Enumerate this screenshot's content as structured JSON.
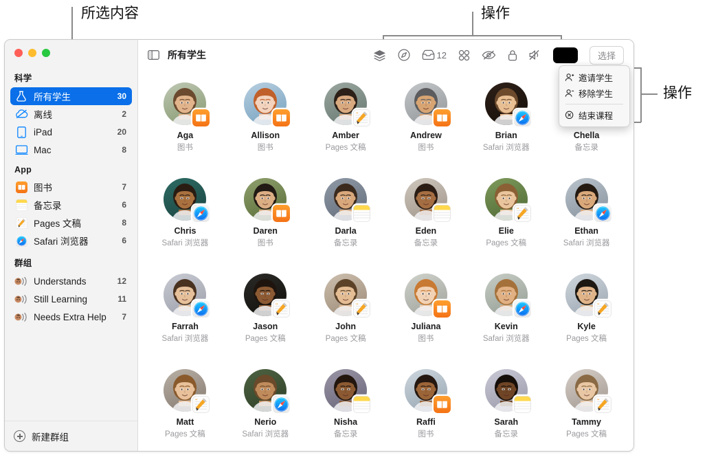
{
  "annotations": [
    {
      "id": "selection",
      "label": "所选内容"
    },
    {
      "id": "actions-top",
      "label": "操作"
    },
    {
      "id": "actions-right",
      "label": "操作"
    }
  ],
  "window": {
    "traffic_lights": [
      "close-red",
      "minimize-yellow",
      "zoom-green"
    ]
  },
  "sidebar": {
    "sections": [
      {
        "title": "科学",
        "items": [
          {
            "icon": "class-flask-icon",
            "label": "所有学生",
            "count": "30",
            "selected": true
          },
          {
            "icon": "offline-cloud-slash-icon",
            "label": "离线",
            "count": "2",
            "selected": false
          },
          {
            "icon": "ipad-icon",
            "label": "iPad",
            "count": "20",
            "selected": false
          },
          {
            "icon": "mac-icon",
            "label": "Mac",
            "count": "8",
            "selected": false
          }
        ]
      },
      {
        "title": "App",
        "items": [
          {
            "icon": "books-app-icon",
            "label": "图书",
            "count": "7",
            "selected": false
          },
          {
            "icon": "notes-app-icon",
            "label": "备忘录",
            "count": "6",
            "selected": false
          },
          {
            "icon": "pages-app-icon",
            "label": "Pages 文稿",
            "count": "8",
            "selected": false
          },
          {
            "icon": "safari-app-icon",
            "label": "Safari 浏览器",
            "count": "6",
            "selected": false
          }
        ]
      },
      {
        "title": "群组",
        "items": [
          {
            "icon": "group-icon",
            "label": "Understands",
            "count": "12",
            "selected": false
          },
          {
            "icon": "group-icon",
            "label": "Still Learning",
            "count": "11",
            "selected": false
          },
          {
            "icon": "group-icon",
            "label": "Needs Extra Help",
            "count": "7",
            "selected": false
          }
        ]
      }
    ],
    "new_group_label": "新建群组"
  },
  "toolbar": {
    "sidebar_toggle_icon": "sidebar-toggle-icon",
    "title": "所有学生",
    "actions": [
      {
        "icon": "layers-icon",
        "label": ""
      },
      {
        "icon": "navigate-compass-icon",
        "label": ""
      },
      {
        "icon": "inbox-icon",
        "label": "12"
      },
      {
        "icon": "grid-apps-icon",
        "label": ""
      },
      {
        "icon": "eye-slash-icon",
        "label": ""
      },
      {
        "icon": "lock-icon",
        "label": ""
      },
      {
        "icon": "speaker-mute-icon",
        "label": ""
      },
      {
        "icon": "screen-black-icon",
        "label": ""
      }
    ],
    "select_button": "选择"
  },
  "popup_menu": {
    "items": [
      {
        "icon": "person-add-icon",
        "label": "邀请学生"
      },
      {
        "icon": "person-remove-icon",
        "label": "移除学生"
      },
      {
        "icon": "end-class-icon",
        "label": "结束课程"
      }
    ],
    "separator_after_index": 1
  },
  "students": [
    {
      "name": "Aga",
      "app": "图书",
      "badge": "books-app-icon",
      "skin": "#e2b48c",
      "hair": "#6b4a2f",
      "bg": "#bfc8b4",
      "bgg": "#8fa07a"
    },
    {
      "name": "Allison",
      "app": "图书",
      "badge": "books-app-icon",
      "skin": "#f3d3bd",
      "hair": "#c0602a",
      "bg": "#b8cfe0",
      "bgg": "#7fa8c4"
    },
    {
      "name": "Amber",
      "app": "Pages 文稿",
      "badge": "pages-app-icon",
      "skin": "#d9a97f",
      "hair": "#2c2018",
      "bg": "#9aa7a0",
      "bgg": "#6f7f78"
    },
    {
      "name": "Andrew",
      "app": "图书",
      "badge": "books-app-icon",
      "skin": "#d7a472",
      "hair": "#5c5c5e",
      "bg": "#c4c7c9",
      "bgg": "#9a9da0"
    },
    {
      "name": "Brian",
      "app": "Safari 浏览器",
      "badge": "safari-app-icon",
      "skin": "#e8bf93",
      "hair": "#6d4a2c",
      "bg": "#2d2018",
      "bgg": "#1a120c"
    },
    {
      "name": "Chella",
      "app": "备忘录",
      "badge": "notes-app-icon",
      "skin": "#caa077",
      "hair": "#3a2a1c",
      "bg": "#9fae84",
      "bgg": "#72855c"
    },
    {
      "name": "Chris",
      "app": "Safari 浏览器",
      "badge": "safari-app-icon",
      "skin": "#a9713f",
      "hair": "#2a1c12",
      "bg": "#2d6b64",
      "bgg": "#1e4a46"
    },
    {
      "name": "Daren",
      "app": "图书",
      "badge": "books-app-icon",
      "skin": "#dcae84",
      "hair": "#221a14",
      "bg": "#8fa06e",
      "bgg": "#62753f"
    },
    {
      "name": "Darla",
      "app": "备忘录",
      "badge": "notes-app-icon",
      "skin": "#d8a87c",
      "hair": "#3b2a1e",
      "bg": "#8f99a6",
      "bgg": "#6a7482"
    },
    {
      "name": "Eden",
      "app": "备忘录",
      "badge": "notes-app-icon",
      "skin": "#a56e42",
      "hair": "#2b1d14",
      "bg": "#cfc7bd",
      "bgg": "#a79c90"
    },
    {
      "name": "Elie",
      "app": "Pages 文稿",
      "badge": "pages-app-icon",
      "skin": "#e9c49c",
      "hair": "#8a6034",
      "bg": "#7f9b5c",
      "bgg": "#55703a"
    },
    {
      "name": "Ethan",
      "app": "Safari 浏览器",
      "badge": "safari-app-icon",
      "skin": "#d9a87a",
      "hair": "#241a12",
      "bg": "#b9c3cc",
      "bgg": "#8e99a4"
    },
    {
      "name": "Farrah",
      "app": "Safari 浏览器",
      "badge": "safari-app-icon",
      "skin": "#e6c09a",
      "hair": "#4a3220",
      "bg": "#c9cbd3",
      "bgg": "#a3a6b0"
    },
    {
      "name": "Jason",
      "app": "Pages 文稿",
      "badge": "pages-app-icon",
      "skin": "#8c5a33",
      "hair": "#1f150e",
      "bg": "#2b2a28",
      "bgg": "#15140f"
    },
    {
      "name": "John",
      "app": "Pages 文稿",
      "badge": "pages-app-icon",
      "skin": "#e4bd95",
      "hair": "#5c4228",
      "bg": "#cdbfae",
      "bgg": "#a3927f"
    },
    {
      "name": "Juliana",
      "app": "图书",
      "badge": "books-app-icon",
      "skin": "#f2d2b5",
      "hair": "#c87a33",
      "bg": "#cfd2cb",
      "bgg": "#a6aaa2"
    },
    {
      "name": "Kevin",
      "app": "Safari 浏览器",
      "badge": "safari-app-icon",
      "skin": "#e1b083",
      "hair": "#a5713a",
      "bg": "#c7cdc6",
      "bgg": "#9ba49a"
    },
    {
      "name": "Kyle",
      "app": "Pages 文稿",
      "badge": "pages-app-icon",
      "skin": "#e0b489",
      "hair": "#1d1812",
      "bg": "#cfd6dd",
      "bgg": "#a4aeb8"
    },
    {
      "name": "Matt",
      "app": "Pages 文稿",
      "badge": "pages-app-icon",
      "skin": "#e8c09a",
      "hair": "#8a5a2c",
      "bg": "#b9b0a5",
      "bgg": "#8d8278"
    },
    {
      "name": "Nerio",
      "app": "Safari 浏览器",
      "badge": "safari-app-icon",
      "skin": "#c08b5b",
      "hair": "#6a4a2a",
      "bg": "#4e6342",
      "bgg": "#33452b"
    },
    {
      "name": "Nisha",
      "app": "备忘录",
      "badge": "notes-app-icon",
      "skin": "#8b5a33",
      "hair": "#22160e",
      "bg": "#9a95a5",
      "bgg": "#706c80"
    },
    {
      "name": "Raffi",
      "app": "图书",
      "badge": "books-app-icon",
      "skin": "#9c6538",
      "hair": "#241810",
      "bg": "#cdd6dd",
      "bgg": "#9fadb8"
    },
    {
      "name": "Sarah",
      "app": "备忘录",
      "badge": "notes-app-icon",
      "skin": "#6f4526",
      "hair": "#160e09",
      "bg": "#c9c9d6",
      "bgg": "#a0a0b0"
    },
    {
      "name": "Tammy",
      "app": "Pages 文稿",
      "badge": "pages-app-icon",
      "skin": "#e9c7a4",
      "hair": "#8a6a44",
      "bg": "#d5cec7",
      "bgg": "#aaa199"
    }
  ]
}
